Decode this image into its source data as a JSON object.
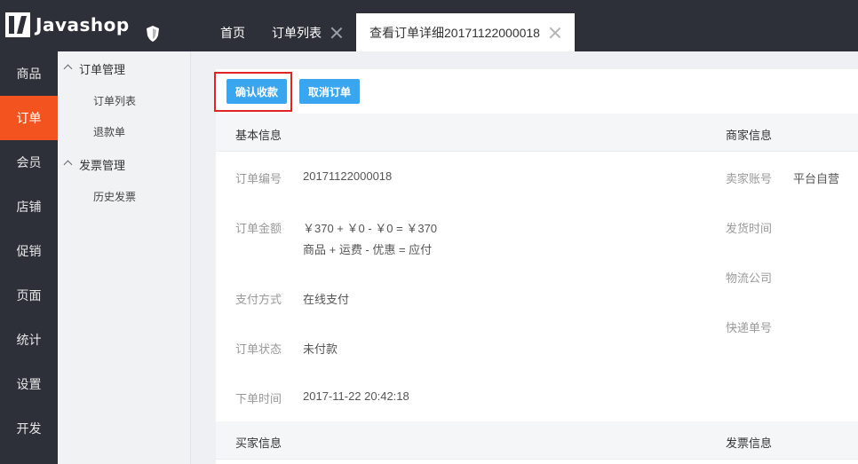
{
  "header": {
    "logo_text": "Javashop",
    "tabs": [
      {
        "label": "首页"
      },
      {
        "label": "订单列表"
      },
      {
        "label": "查看订单详细20171122000018"
      }
    ]
  },
  "main_nav": [
    "商品",
    "订单",
    "会员",
    "店铺",
    "促销",
    "页面",
    "统计",
    "设置",
    "开发"
  ],
  "sub_nav": {
    "group1": "订单管理",
    "group1_items": [
      "订单列表",
      "退款单"
    ],
    "group2": "发票管理",
    "group2_items": [
      "历史发票"
    ]
  },
  "actions": {
    "confirm_receipt": "确认收款",
    "cancel_order": "取消订单"
  },
  "basic_info": {
    "title": "基本信息",
    "order_no_label": "订单编号",
    "order_no": "20171122000018",
    "amount_label": "订单金额",
    "amount_formula": "￥370 + ￥0 - ￥0 = ￥370",
    "amount_desc": "商品 + 运费 - 优惠 = 应付",
    "pay_method_label": "支付方式",
    "pay_method": "在线支付",
    "status_label": "订单状态",
    "status": "未付款",
    "created_label": "下单时间",
    "created": "2017-11-22 20:42:18"
  },
  "merchant_info": {
    "title": "商家信息",
    "seller_label": "卖家账号",
    "seller": "平台自营",
    "ship_time_label": "发货时间",
    "logistics_label": "物流公司",
    "tracking_label": "快递单号"
  },
  "buyer_info": {
    "title": "买家信息"
  },
  "invoice_info": {
    "title": "发票信息"
  },
  "colors": {
    "topbar": "#2d3039",
    "accent": "#f2531f",
    "button": "#3aa6f0",
    "highlight": "#e02424"
  }
}
